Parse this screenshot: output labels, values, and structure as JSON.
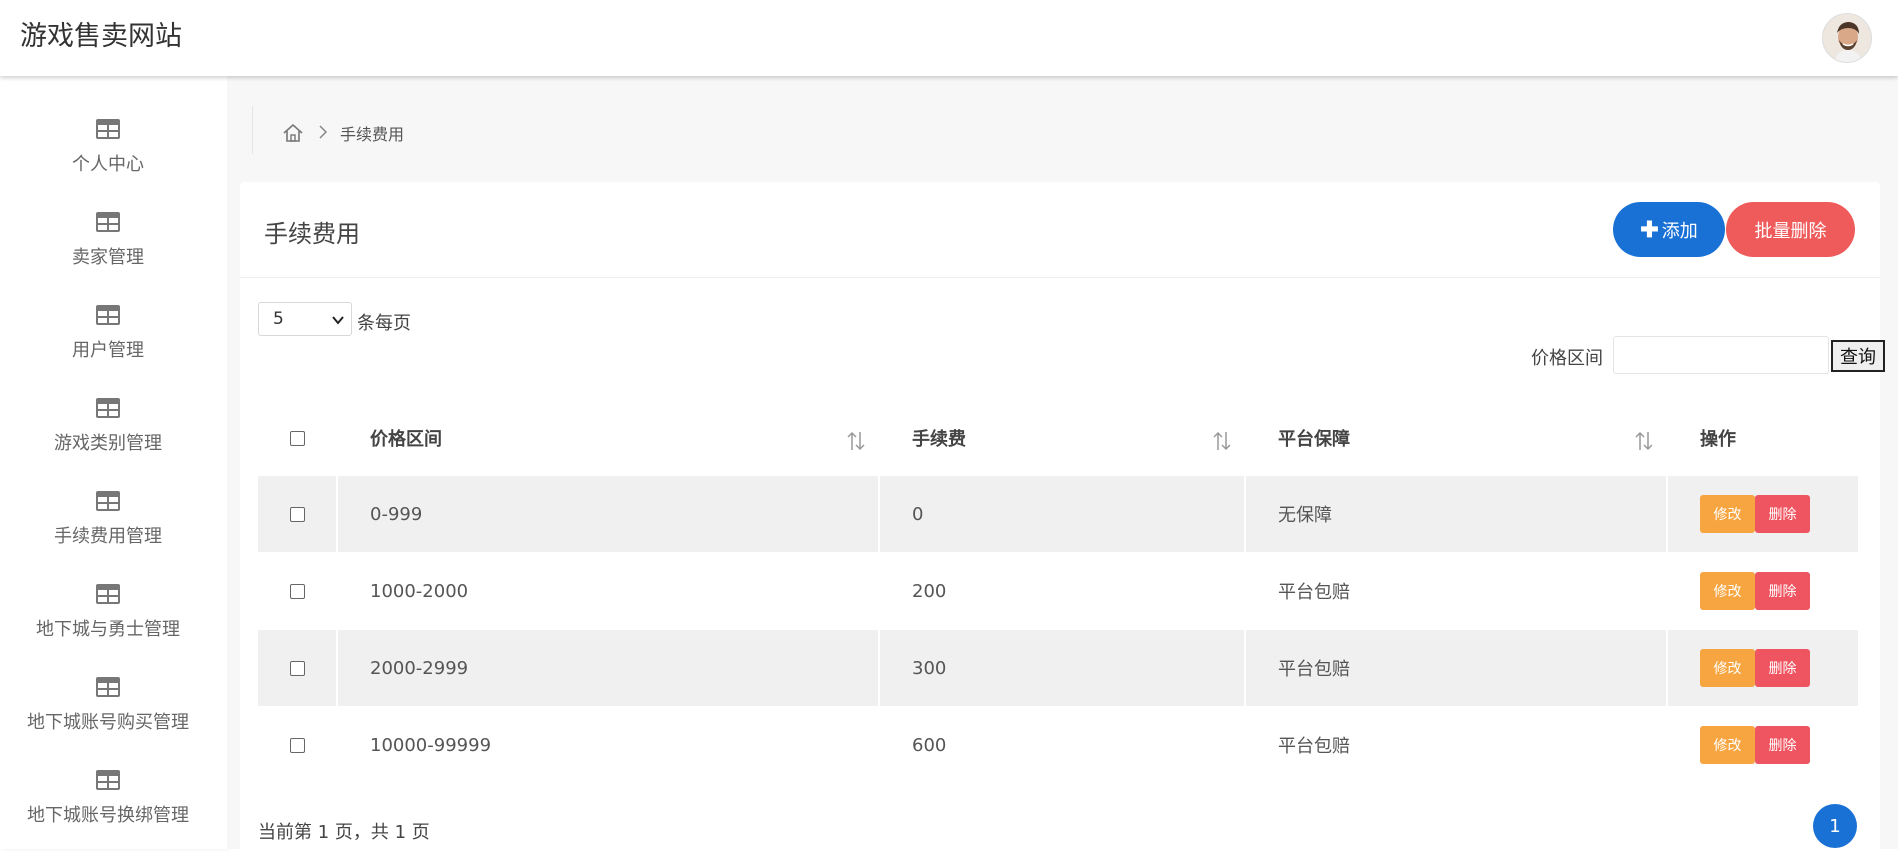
{
  "header": {
    "app_title": "游戏售卖网站",
    "avatar_icon": "user-avatar"
  },
  "sidebar": {
    "items": [
      {
        "label": "个人中心",
        "icon": "table-icon"
      },
      {
        "label": "卖家管理",
        "icon": "table-icon"
      },
      {
        "label": "用户管理",
        "icon": "table-icon"
      },
      {
        "label": "游戏类别管理",
        "icon": "table-icon"
      },
      {
        "label": "手续费用管理",
        "icon": "table-icon"
      },
      {
        "label": "地下城与勇士管理",
        "icon": "table-icon"
      },
      {
        "label": "地下城账号购买管理",
        "icon": "table-icon"
      },
      {
        "label": "地下城账号换绑管理",
        "icon": "table-icon"
      }
    ]
  },
  "breadcrumb": {
    "home_icon": "home-icon",
    "current": "手续费用"
  },
  "panel": {
    "title": "手续费用",
    "add_label": "添加",
    "batch_delete_label": "批量删除"
  },
  "pagesize": {
    "value": "5",
    "label": "条每页"
  },
  "filter": {
    "label": "价格区间",
    "value": "",
    "query_label": "查询"
  },
  "table": {
    "headers": [
      "价格区间",
      "手续费",
      "平台保障",
      "操作"
    ],
    "rows": [
      {
        "price_range": "0-999",
        "fee": "0",
        "guarantee": "无保障"
      },
      {
        "price_range": "1000-2000",
        "fee": "200",
        "guarantee": "平台包赔"
      },
      {
        "price_range": "2000-2999",
        "fee": "300",
        "guarantee": "平台包赔"
      },
      {
        "price_range": "10000-99999",
        "fee": "600",
        "guarantee": "平台包赔"
      }
    ],
    "edit_label": "修改",
    "delete_label": "删除"
  },
  "pager": {
    "summary": "当前第 1 页，共 1 页",
    "current_page": "1"
  },
  "colors": {
    "primary": "#1971d6",
    "danger": "#ef5b5b",
    "warning": "#f7a541",
    "row_alt": "#f0f0f0"
  }
}
